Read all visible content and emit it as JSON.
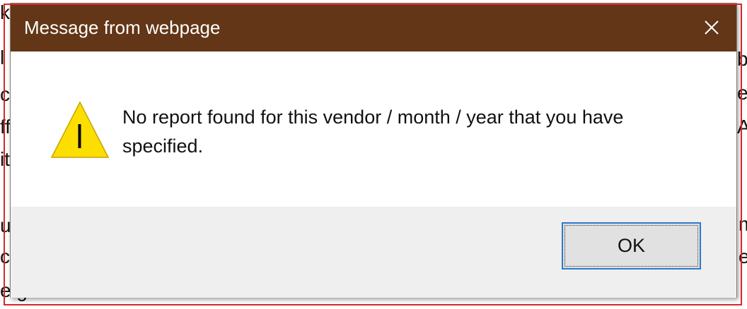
{
  "dialog": {
    "title": "Message from webpage",
    "close_icon": "close-icon",
    "warning_icon": "warning-icon",
    "message": "No report found for this vendor / month / year that you have specified.",
    "ok_label": "OK"
  },
  "colors": {
    "titlebar": "#623616",
    "footer": "#efefef",
    "button_border": "#2f79cc",
    "button_bg": "#e1e1e1",
    "warning_fill": "#fcdf00",
    "outline": "#d9262b"
  }
}
